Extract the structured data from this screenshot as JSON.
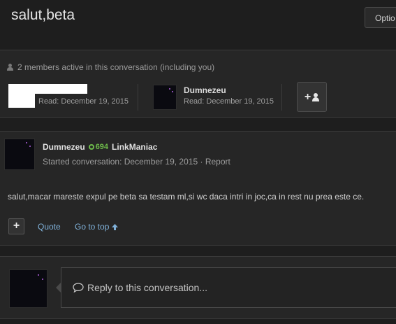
{
  "header": {
    "title": "salut,beta",
    "options_label": "Optio"
  },
  "members_panel": {
    "summary": "2 members active in this conversation (including you)",
    "members": [
      {
        "name": "",
        "read": "Read: December 19, 2015"
      },
      {
        "name": "Dumnezeu",
        "read": "Read: December 19, 2015"
      }
    ],
    "invite_icon": "add-user-icon"
  },
  "post": {
    "author": "Dumnezeu",
    "score": "694",
    "rank": "LinkManiac",
    "meta": "Started conversation: December 19, 2015",
    "separator": "·",
    "report_label": "Report",
    "body": "salut,macar mareste expul pe beta sa testam ml,si wc daca intri in joc,ca in rest nu prea este ce.",
    "multiquote_label": "+",
    "quote_label": "Quote",
    "go_top_label": "Go to top"
  },
  "reply": {
    "placeholder": "Reply to this conversation..."
  },
  "colors": {
    "accent": "#7fb0d8",
    "score": "#6dbb4a",
    "background": "#1e1e1e"
  }
}
